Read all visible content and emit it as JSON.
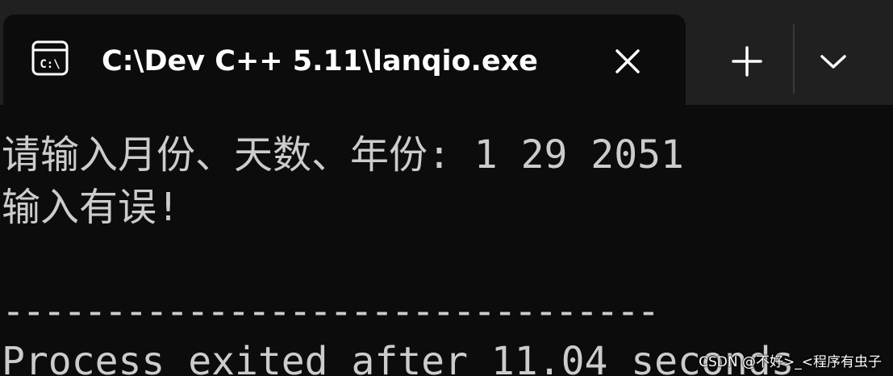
{
  "window": {
    "tab_title": "C:\\Dev C++ 5.11\\lanqio.exe"
  },
  "icons": {
    "tab": "console-icon",
    "close": "close-icon",
    "new_tab": "plus-icon",
    "dropdown": "chevron-down-icon"
  },
  "console": {
    "lines": [
      "请输入月份、天数、年份: 1 29 2051",
      "输入有误!",
      "--------------------------------",
      "Process exited after 11.04 seconds"
    ]
  },
  "watermark": {
    "text": "CSDN @不好>_<程序有虫子"
  },
  "colors": {
    "background": "#0c0c0c",
    "titlebar": "#202020",
    "text": "#cccccc"
  }
}
